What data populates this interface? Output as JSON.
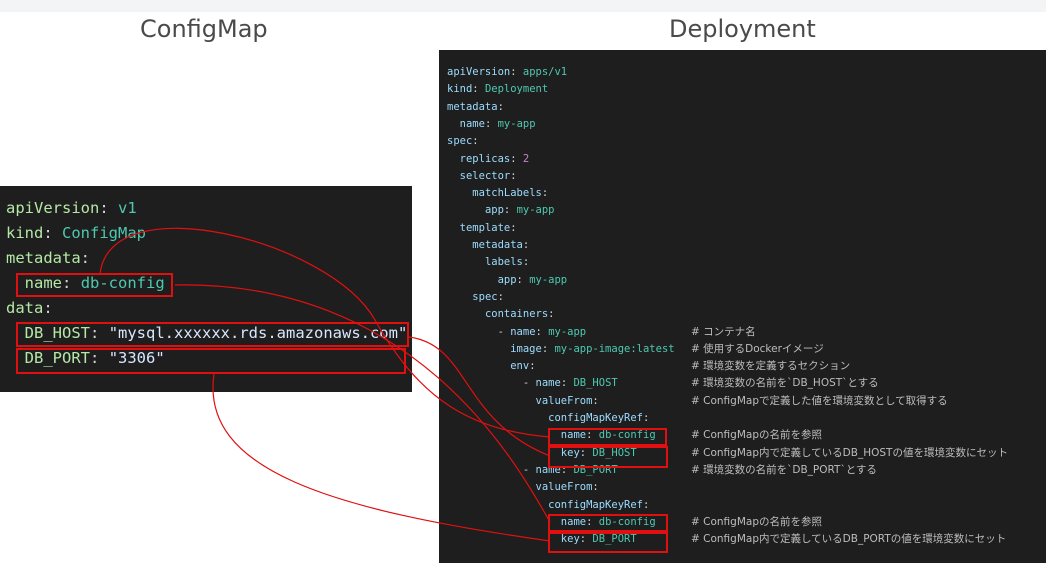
{
  "titles": {
    "configmap": "ConfigMap",
    "deployment": "Deployment"
  },
  "configmap": {
    "lines": [
      {
        "indent": 0,
        "key": "apiVersion",
        "value": "v1",
        "vtype": "v"
      },
      {
        "indent": 0,
        "key": "kind",
        "value": "ConfigMap",
        "vtype": "v"
      },
      {
        "indent": 0,
        "key": "metadata",
        "value": "",
        "vtype": "v"
      },
      {
        "indent": 1,
        "key": "name",
        "value": "db-config",
        "vtype": "v"
      },
      {
        "indent": 0,
        "key": "data",
        "value": "",
        "vtype": "v"
      },
      {
        "indent": 1,
        "key": "DB_HOST",
        "value": "\"mysql.xxxxxx.rds.amazonaws.com\"",
        "vtype": "sv"
      },
      {
        "indent": 1,
        "key": "DB_PORT",
        "value": "\"3306\"",
        "vtype": "sv"
      }
    ]
  },
  "deployment": {
    "lines": [
      {
        "indent": 0,
        "key": "apiVersion",
        "value": "apps/v1",
        "vtype": "v",
        "comment": ""
      },
      {
        "indent": 0,
        "key": "kind",
        "value": "Deployment",
        "vtype": "v",
        "comment": ""
      },
      {
        "indent": 0,
        "key": "metadata",
        "value": "",
        "vtype": "v",
        "comment": ""
      },
      {
        "indent": 1,
        "key": "name",
        "value": "my-app",
        "vtype": "v",
        "comment": ""
      },
      {
        "indent": 0,
        "key": "spec",
        "value": "",
        "vtype": "v",
        "comment": ""
      },
      {
        "indent": 1,
        "key": "replicas",
        "value": "2",
        "vtype": "n",
        "comment": ""
      },
      {
        "indent": 1,
        "key": "selector",
        "value": "",
        "vtype": "v",
        "comment": ""
      },
      {
        "indent": 2,
        "key": "matchLabels",
        "value": "",
        "vtype": "v",
        "comment": ""
      },
      {
        "indent": 3,
        "key": "app",
        "value": "my-app",
        "vtype": "v",
        "comment": ""
      },
      {
        "indent": 1,
        "key": "template",
        "value": "",
        "vtype": "v",
        "comment": ""
      },
      {
        "indent": 2,
        "key": "metadata",
        "value": "",
        "vtype": "v",
        "comment": ""
      },
      {
        "indent": 3,
        "key": "labels",
        "value": "",
        "vtype": "v",
        "comment": ""
      },
      {
        "indent": 4,
        "key": "app",
        "value": "my-app",
        "vtype": "v",
        "comment": ""
      },
      {
        "indent": 2,
        "key": "spec",
        "value": "",
        "vtype": "v",
        "comment": ""
      },
      {
        "indent": 3,
        "key": "containers",
        "value": "",
        "vtype": "v",
        "comment": ""
      },
      {
        "indent": 4,
        "dash": true,
        "key": "name",
        "value": "my-app",
        "vtype": "v",
        "comment": "# コンテナ名"
      },
      {
        "indent": 5,
        "key": "image",
        "value": "my-app-image:latest",
        "vtype": "v",
        "comment": "# 使用するDockerイメージ"
      },
      {
        "indent": 5,
        "key": "env",
        "value": "",
        "vtype": "v",
        "comment": "# 環境変数を定義するセクション"
      },
      {
        "indent": 6,
        "dash": true,
        "key": "name",
        "value": "DB_HOST",
        "vtype": "v",
        "comment": "# 環境変数の名前を`DB_HOST`とする"
      },
      {
        "indent": 7,
        "key": "valueFrom",
        "value": "",
        "vtype": "v",
        "comment": "# ConfigMapで定義した値を環境変数として取得する"
      },
      {
        "indent": 8,
        "key": "configMapKeyRef",
        "value": "",
        "vtype": "v",
        "comment": ""
      },
      {
        "indent": 9,
        "key": "name",
        "value": "db-config",
        "vtype": "v",
        "comment": "# ConfigMapの名前を参照"
      },
      {
        "indent": 9,
        "key": "key",
        "value": "DB_HOST",
        "vtype": "v",
        "comment": "# ConfigMap内で定義しているDB_HOSTの値を環境変数にセット"
      },
      {
        "indent": 6,
        "dash": true,
        "key": "name",
        "value": "DB_PORT",
        "vtype": "v",
        "comment": "# 環境変数の名前を`DB_PORT`とする"
      },
      {
        "indent": 7,
        "key": "valueFrom",
        "value": "",
        "vtype": "v",
        "comment": ""
      },
      {
        "indent": 8,
        "key": "configMapKeyRef",
        "value": "",
        "vtype": "v",
        "comment": ""
      },
      {
        "indent": 9,
        "key": "name",
        "value": "db-config",
        "vtype": "v",
        "comment": "# ConfigMapの名前を参照"
      },
      {
        "indent": 9,
        "key": "key",
        "value": "DB_PORT",
        "vtype": "v",
        "comment": "# ConfigMap内で定義しているDB_PORTの値を環境変数にセット"
      }
    ]
  },
  "colors": {
    "panel_bg": "#1e1e1e",
    "key": "#9cdcfe",
    "value": "#4ec9b0",
    "number": "#c586c0",
    "comment": "#bdbdbd",
    "highlight": "#e01010"
  }
}
